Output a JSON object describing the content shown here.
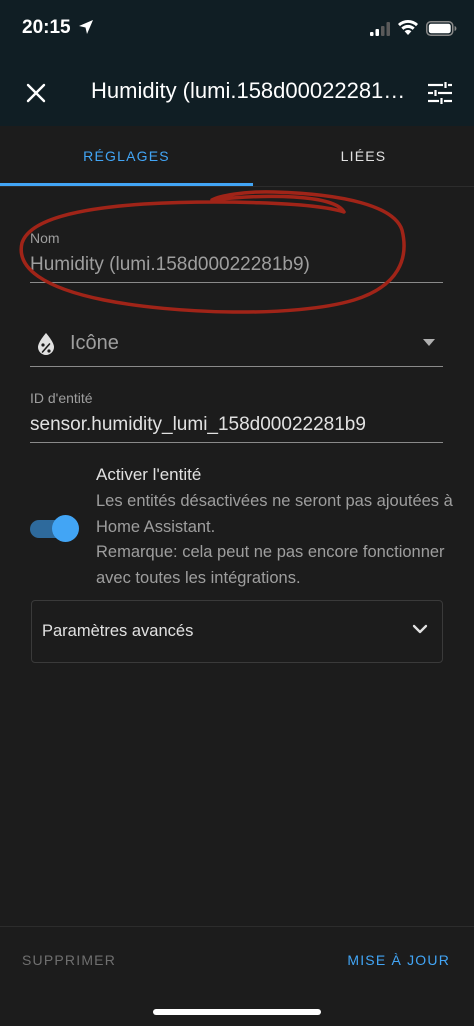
{
  "status_bar": {
    "time": "20:15"
  },
  "app_bar": {
    "title": "Humidity (lumi.158d00022281b9)",
    "close_icon": "close-icon",
    "settings_icon": "tune-icon"
  },
  "tabs": [
    {
      "label": "RÉGLAGES",
      "active": true
    },
    {
      "label": "LIÉES",
      "active": false
    }
  ],
  "form": {
    "name": {
      "label": "Nom",
      "value": "Humidity (lumi.158d00022281b9)"
    },
    "icon": {
      "label": "Icône",
      "icon": "water-percent-icon"
    },
    "entity_id": {
      "label": "ID d'entité",
      "value": "sensor.humidity_lumi_158d00022281b9"
    },
    "enable": {
      "title": "Activer l'entité",
      "description_1": "Les entités désactivées ne seront pas ajoutées à Home Assistant.",
      "description_2": "Remarque: cela peut ne pas encore fonctionner avec toutes les intégrations.",
      "checked": true
    },
    "advanced": {
      "label": "Paramètres avancés"
    }
  },
  "footer": {
    "delete_label": "SUPPRIMER",
    "update_label": "MISE À JOUR"
  },
  "colors": {
    "accent": "#42a5f5",
    "background": "#1c1c1c",
    "header": "#101e24",
    "annotation": "#a02418"
  }
}
